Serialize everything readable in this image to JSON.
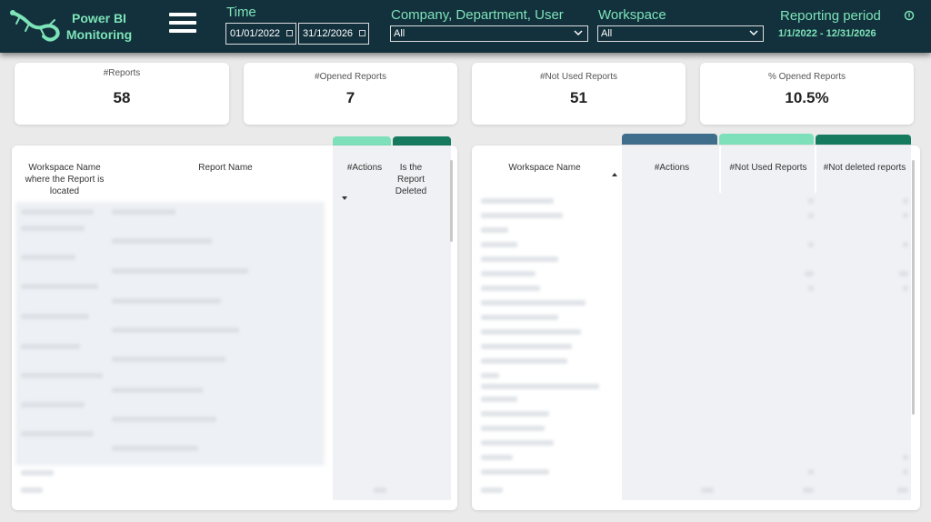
{
  "header": {
    "logo_text": "Power BI Monitoring",
    "time_label": "Time",
    "date_from": "01/01/2022",
    "date_to": "31/12/2026",
    "company_label": "Company, Department, User",
    "company_value": "All",
    "workspace_label": "Workspace",
    "workspace_value": "All",
    "period_label": "Reporting period",
    "period_value": "1/1/2022 - 12/31/2026"
  },
  "kpis": [
    {
      "label": "#Reports",
      "value": "58"
    },
    {
      "label": "#Opened Reports",
      "value": "7"
    },
    {
      "label": "#Not Used Reports",
      "value": "51"
    },
    {
      "label": "% Opened Reports",
      "value": "10.5%"
    }
  ],
  "left_table": {
    "columns": [
      "Workspace Name where the Report is located",
      "Report Name",
      "#Actions",
      "Is the Report Deleted"
    ]
  },
  "right_table": {
    "columns": [
      "Workspace Name",
      "#Actions",
      "#Not Used Reports",
      "#Not deleted reports"
    ]
  },
  "colors": {
    "header_bg": "#13313d",
    "accent_text": "#7de3b8",
    "tab_mint": "#7ee0bb",
    "tab_dark_green": "#167a5e",
    "tab_steel_blue": "#3f6e8c"
  }
}
